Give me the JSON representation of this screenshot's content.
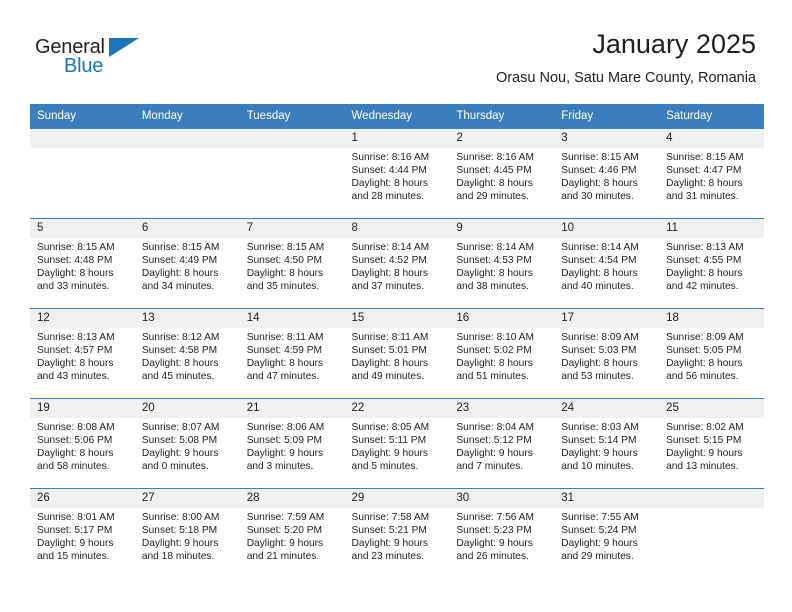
{
  "brand": {
    "name_part1": "General",
    "name_part2": "Blue",
    "accent_color": "#1b75bc"
  },
  "header": {
    "month_title": "January 2025",
    "location": "Orasu Nou, Satu Mare County, Romania"
  },
  "theme": {
    "header_row_bg": "#3a7ebe",
    "day_number_bg": "#f0f0f0",
    "text_color": "#231f20"
  },
  "calendar": {
    "weekday_headers": [
      "Sunday",
      "Monday",
      "Tuesday",
      "Wednesday",
      "Thursday",
      "Friday",
      "Saturday"
    ],
    "weeks": [
      [
        {
          "day": "",
          "blank": true,
          "sunrise": "",
          "sunset": "",
          "daylight1": "",
          "daylight2": ""
        },
        {
          "day": "",
          "blank": true,
          "sunrise": "",
          "sunset": "",
          "daylight1": "",
          "daylight2": ""
        },
        {
          "day": "",
          "blank": true,
          "sunrise": "",
          "sunset": "",
          "daylight1": "",
          "daylight2": ""
        },
        {
          "day": "1",
          "sunrise": "Sunrise: 8:16 AM",
          "sunset": "Sunset: 4:44 PM",
          "daylight1": "Daylight: 8 hours",
          "daylight2": "and 28 minutes."
        },
        {
          "day": "2",
          "sunrise": "Sunrise: 8:16 AM",
          "sunset": "Sunset: 4:45 PM",
          "daylight1": "Daylight: 8 hours",
          "daylight2": "and 29 minutes."
        },
        {
          "day": "3",
          "sunrise": "Sunrise: 8:15 AM",
          "sunset": "Sunset: 4:46 PM",
          "daylight1": "Daylight: 8 hours",
          "daylight2": "and 30 minutes."
        },
        {
          "day": "4",
          "sunrise": "Sunrise: 8:15 AM",
          "sunset": "Sunset: 4:47 PM",
          "daylight1": "Daylight: 8 hours",
          "daylight2": "and 31 minutes."
        }
      ],
      [
        {
          "day": "5",
          "sunrise": "Sunrise: 8:15 AM",
          "sunset": "Sunset: 4:48 PM",
          "daylight1": "Daylight: 8 hours",
          "daylight2": "and 33 minutes."
        },
        {
          "day": "6",
          "sunrise": "Sunrise: 8:15 AM",
          "sunset": "Sunset: 4:49 PM",
          "daylight1": "Daylight: 8 hours",
          "daylight2": "and 34 minutes."
        },
        {
          "day": "7",
          "sunrise": "Sunrise: 8:15 AM",
          "sunset": "Sunset: 4:50 PM",
          "daylight1": "Daylight: 8 hours",
          "daylight2": "and 35 minutes."
        },
        {
          "day": "8",
          "sunrise": "Sunrise: 8:14 AM",
          "sunset": "Sunset: 4:52 PM",
          "daylight1": "Daylight: 8 hours",
          "daylight2": "and 37 minutes."
        },
        {
          "day": "9",
          "sunrise": "Sunrise: 8:14 AM",
          "sunset": "Sunset: 4:53 PM",
          "daylight1": "Daylight: 8 hours",
          "daylight2": "and 38 minutes."
        },
        {
          "day": "10",
          "sunrise": "Sunrise: 8:14 AM",
          "sunset": "Sunset: 4:54 PM",
          "daylight1": "Daylight: 8 hours",
          "daylight2": "and 40 minutes."
        },
        {
          "day": "11",
          "sunrise": "Sunrise: 8:13 AM",
          "sunset": "Sunset: 4:55 PM",
          "daylight1": "Daylight: 8 hours",
          "daylight2": "and 42 minutes."
        }
      ],
      [
        {
          "day": "12",
          "sunrise": "Sunrise: 8:13 AM",
          "sunset": "Sunset: 4:57 PM",
          "daylight1": "Daylight: 8 hours",
          "daylight2": "and 43 minutes."
        },
        {
          "day": "13",
          "sunrise": "Sunrise: 8:12 AM",
          "sunset": "Sunset: 4:58 PM",
          "daylight1": "Daylight: 8 hours",
          "daylight2": "and 45 minutes."
        },
        {
          "day": "14",
          "sunrise": "Sunrise: 8:11 AM",
          "sunset": "Sunset: 4:59 PM",
          "daylight1": "Daylight: 8 hours",
          "daylight2": "and 47 minutes."
        },
        {
          "day": "15",
          "sunrise": "Sunrise: 8:11 AM",
          "sunset": "Sunset: 5:01 PM",
          "daylight1": "Daylight: 8 hours",
          "daylight2": "and 49 minutes."
        },
        {
          "day": "16",
          "sunrise": "Sunrise: 8:10 AM",
          "sunset": "Sunset: 5:02 PM",
          "daylight1": "Daylight: 8 hours",
          "daylight2": "and 51 minutes."
        },
        {
          "day": "17",
          "sunrise": "Sunrise: 8:09 AM",
          "sunset": "Sunset: 5:03 PM",
          "daylight1": "Daylight: 8 hours",
          "daylight2": "and 53 minutes."
        },
        {
          "day": "18",
          "sunrise": "Sunrise: 8:09 AM",
          "sunset": "Sunset: 5:05 PM",
          "daylight1": "Daylight: 8 hours",
          "daylight2": "and 56 minutes."
        }
      ],
      [
        {
          "day": "19",
          "sunrise": "Sunrise: 8:08 AM",
          "sunset": "Sunset: 5:06 PM",
          "daylight1": "Daylight: 8 hours",
          "daylight2": "and 58 minutes."
        },
        {
          "day": "20",
          "sunrise": "Sunrise: 8:07 AM",
          "sunset": "Sunset: 5:08 PM",
          "daylight1": "Daylight: 9 hours",
          "daylight2": "and 0 minutes."
        },
        {
          "day": "21",
          "sunrise": "Sunrise: 8:06 AM",
          "sunset": "Sunset: 5:09 PM",
          "daylight1": "Daylight: 9 hours",
          "daylight2": "and 3 minutes."
        },
        {
          "day": "22",
          "sunrise": "Sunrise: 8:05 AM",
          "sunset": "Sunset: 5:11 PM",
          "daylight1": "Daylight: 9 hours",
          "daylight2": "and 5 minutes."
        },
        {
          "day": "23",
          "sunrise": "Sunrise: 8:04 AM",
          "sunset": "Sunset: 5:12 PM",
          "daylight1": "Daylight: 9 hours",
          "daylight2": "and 7 minutes."
        },
        {
          "day": "24",
          "sunrise": "Sunrise: 8:03 AM",
          "sunset": "Sunset: 5:14 PM",
          "daylight1": "Daylight: 9 hours",
          "daylight2": "and 10 minutes."
        },
        {
          "day": "25",
          "sunrise": "Sunrise: 8:02 AM",
          "sunset": "Sunset: 5:15 PM",
          "daylight1": "Daylight: 9 hours",
          "daylight2": "and 13 minutes."
        }
      ],
      [
        {
          "day": "26",
          "sunrise": "Sunrise: 8:01 AM",
          "sunset": "Sunset: 5:17 PM",
          "daylight1": "Daylight: 9 hours",
          "daylight2": "and 15 minutes."
        },
        {
          "day": "27",
          "sunrise": "Sunrise: 8:00 AM",
          "sunset": "Sunset: 5:18 PM",
          "daylight1": "Daylight: 9 hours",
          "daylight2": "and 18 minutes."
        },
        {
          "day": "28",
          "sunrise": "Sunrise: 7:59 AM",
          "sunset": "Sunset: 5:20 PM",
          "daylight1": "Daylight: 9 hours",
          "daylight2": "and 21 minutes."
        },
        {
          "day": "29",
          "sunrise": "Sunrise: 7:58 AM",
          "sunset": "Sunset: 5:21 PM",
          "daylight1": "Daylight: 9 hours",
          "daylight2": "and 23 minutes."
        },
        {
          "day": "30",
          "sunrise": "Sunrise: 7:56 AM",
          "sunset": "Sunset: 5:23 PM",
          "daylight1": "Daylight: 9 hours",
          "daylight2": "and 26 minutes."
        },
        {
          "day": "31",
          "sunrise": "Sunrise: 7:55 AM",
          "sunset": "Sunset: 5:24 PM",
          "daylight1": "Daylight: 9 hours",
          "daylight2": "and 29 minutes."
        },
        {
          "day": "",
          "blank": true,
          "sunrise": "",
          "sunset": "",
          "daylight1": "",
          "daylight2": ""
        }
      ]
    ]
  }
}
